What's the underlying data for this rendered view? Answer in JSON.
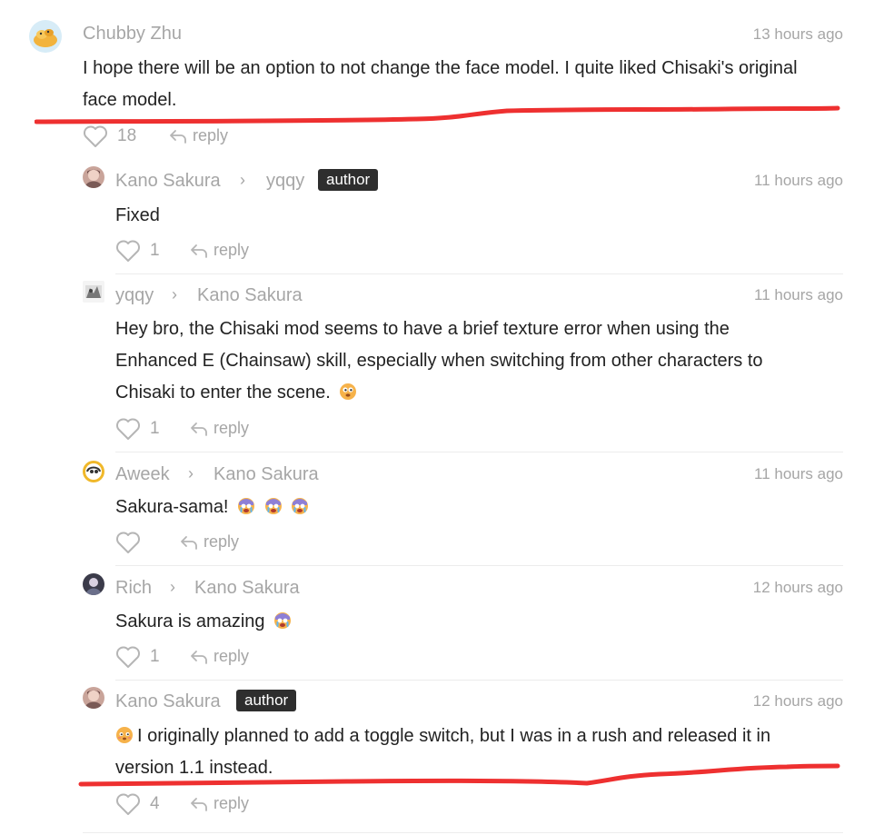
{
  "main_comment": {
    "author": "Chubby Zhu",
    "time": "13 hours ago",
    "text_line1": "I hope there will be an option to not change the face model. I quite liked Chisaki's original",
    "text_line2": "face model.",
    "likes": "18",
    "reply_label": "reply"
  },
  "replies": [
    {
      "author": "Kano Sakura",
      "reply_to": "yqqy",
      "badge": "author",
      "time": "11 hours ago",
      "text": "Fixed",
      "likes": "1",
      "reply_label": "reply"
    },
    {
      "author": "yqqy",
      "reply_to": "Kano Sakura",
      "time": "11 hours ago",
      "text_line1": "Hey bro, the Chisaki mod seems to have a brief texture error when using the",
      "text_line2": "Enhanced E (Chainsaw) skill, especially when switching from other characters to",
      "text_line3": "Chisaki to enter the scene.",
      "likes": "1",
      "reply_label": "reply"
    },
    {
      "author": "Aweek",
      "reply_to": "Kano Sakura",
      "time": "11 hours ago",
      "text": "Sakura-sama!",
      "likes": "",
      "reply_label": "reply"
    },
    {
      "author": "Rich",
      "reply_to": "Kano Sakura",
      "time": "12 hours ago",
      "text": "Sakura is amazing",
      "likes": "1",
      "reply_label": "reply"
    },
    {
      "author": "Kano Sakura",
      "badge": "author",
      "time": "12 hours ago",
      "text_line1": "I originally planned to add a toggle switch, but I was in a rush and released it in",
      "text_line2": "version 1.1 instead.",
      "likes": "4",
      "reply_label": "reply"
    }
  ],
  "icons": {
    "like": "heart-outline-icon",
    "reply": "reply-arrow-icon",
    "chevron": "chevron-right-icon"
  },
  "colors": {
    "muted_text": "#a6a6a6",
    "badge_bg": "#2e2e2e",
    "annotation_red": "#ee3030"
  }
}
